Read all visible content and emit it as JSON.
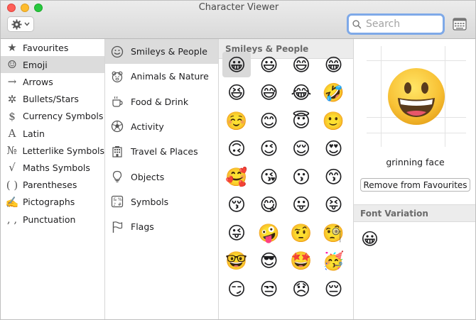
{
  "window": {
    "title": "Character Viewer"
  },
  "toolbar": {
    "search_placeholder": "Search"
  },
  "categories": [
    {
      "icon": "★",
      "label": "Favourites",
      "selected": false
    },
    {
      "icon": "☺",
      "label": "Emoji",
      "selected": true
    },
    {
      "icon": "→",
      "label": "Arrows",
      "selected": false
    },
    {
      "icon": "✲",
      "label": "Bullets/Stars",
      "selected": false
    },
    {
      "icon": "$",
      "label": "Currency Symbols",
      "selected": false
    },
    {
      "icon": "A",
      "label": "Latin",
      "selected": false
    },
    {
      "icon": "№",
      "label": "Letterlike Symbols",
      "selected": false
    },
    {
      "icon": "√",
      "label": "Maths Symbols",
      "selected": false
    },
    {
      "icon": "( )",
      "label": "Parentheses",
      "selected": false
    },
    {
      "icon": "✍",
      "label": "Pictographs",
      "selected": false
    },
    {
      "icon": ", ,",
      "label": "Punctuation",
      "selected": false
    }
  ],
  "subcategories": [
    {
      "icon": "smiley-icon",
      "label": "Smileys & People",
      "selected": true
    },
    {
      "icon": "bear-icon",
      "label": "Animals & Nature",
      "selected": false
    },
    {
      "icon": "cup-icon",
      "label": "Food & Drink",
      "selected": false
    },
    {
      "icon": "ball-icon",
      "label": "Activity",
      "selected": false
    },
    {
      "icon": "building-icon",
      "label": "Travel & Places",
      "selected": false
    },
    {
      "icon": "bulb-icon",
      "label": "Objects",
      "selected": false
    },
    {
      "icon": "symbols-icon",
      "label": "Symbols",
      "selected": false
    },
    {
      "icon": "flag-icon",
      "label": "Flags",
      "selected": false
    }
  ],
  "grid": {
    "header": "Smileys & People",
    "emojis": [
      "😀",
      "😃",
      "😄",
      "😁",
      "😆",
      "😅",
      "😂",
      "🤣",
      "☺️",
      "😊",
      "😇",
      "🙂",
      "🙃",
      "😉",
      "😌",
      "😍",
      "🥰",
      "😘",
      "😗",
      "😙",
      "😚",
      "😋",
      "😛",
      "😝",
      "😜",
      "🤪",
      "🤨",
      "🧐",
      "🤓",
      "😎",
      "🤩",
      "🥳",
      "😏",
      "😒",
      "😞",
      "😔"
    ],
    "selected_index": 0
  },
  "detail": {
    "preview_emoji": "😀",
    "name": "grinning face",
    "remove_label": "Remove from Favourites",
    "font_variation_header": "Font Variation",
    "variation_emoji": "😀"
  },
  "colors": {
    "accent": "#7ea9e8",
    "selected_row": "#dcdcdc",
    "emoji_face": "#f8c236"
  }
}
